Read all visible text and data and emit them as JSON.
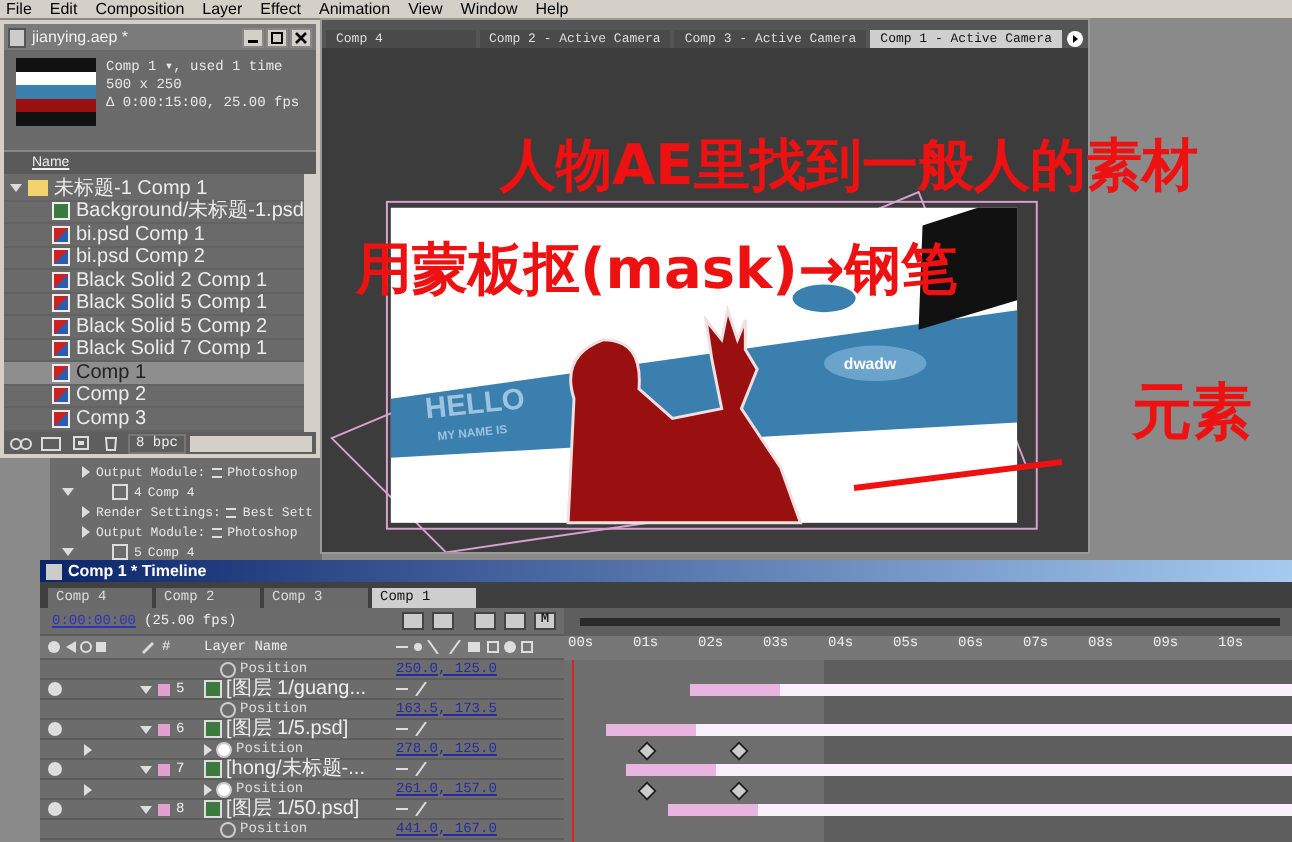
{
  "menu": [
    "File",
    "Edit",
    "Composition",
    "Layer",
    "Effect",
    "Animation",
    "View",
    "Window",
    "Help"
  ],
  "project": {
    "title": "jianying.aep *",
    "info": [
      "Comp 1 ▾, used 1 time",
      "500 x 250",
      "Δ 0:00:15:00, 25.00 fps"
    ],
    "column": "Name",
    "bpc": "8 bpc",
    "items": [
      {
        "name": "未标题-1 Comp 1",
        "kind": "folder",
        "expanded": true,
        "selected": false,
        "children": [
          {
            "name": "Background/未标题-1.psd",
            "kind": "footage",
            "selected": false
          },
          {
            "name": "bi.psd Comp 1",
            "kind": "comp",
            "selected": false
          },
          {
            "name": "bi.psd Comp 2",
            "kind": "comp",
            "selected": false
          },
          {
            "name": "Black Solid 2 Comp 1",
            "kind": "comp",
            "selected": false
          },
          {
            "name": "Black Solid 5 Comp 1",
            "kind": "comp",
            "selected": false
          },
          {
            "name": "Black Solid 5 Comp 2",
            "kind": "comp",
            "selected": false
          },
          {
            "name": "Black Solid 7 Comp 1",
            "kind": "comp",
            "selected": false
          },
          {
            "name": "Comp 1",
            "kind": "comp",
            "selected": true
          },
          {
            "name": "Comp 2",
            "kind": "comp",
            "selected": false
          },
          {
            "name": "Comp 3",
            "kind": "comp",
            "selected": false
          }
        ]
      }
    ]
  },
  "render_queue": [
    {
      "kind": "setting",
      "label": "Output Module:",
      "value": "Photoshop"
    },
    {
      "kind": "item",
      "number": "4",
      "name": "Comp 4",
      "checked": false
    },
    {
      "kind": "setting",
      "label": "Render Settings:",
      "value": "Best Sett"
    },
    {
      "kind": "setting",
      "label": "Output Module:",
      "value": "Photoshop"
    },
    {
      "kind": "item",
      "number": "5",
      "name": "Comp 4",
      "checked": false
    }
  ],
  "viewer": {
    "tabs": [
      {
        "label": "Comp 4",
        "selected": false
      },
      {
        "label": "Comp 2 - Active Camera",
        "selected": false
      },
      {
        "label": "Comp 3 - Active Camera",
        "selected": false
      },
      {
        "label": "Comp 1 - Active Camera",
        "selected": true
      }
    ],
    "artwork_texts": [
      "HELLO",
      "MY NAME IS",
      "dwadw"
    ]
  },
  "annotations": [
    "人物AE里找到一般人的素材",
    "用蒙板抠(mask)→钢笔",
    "元素"
  ],
  "timeline": {
    "title": "Comp 1 * Timeline",
    "tabs": [
      {
        "label": "Comp 4",
        "selected": false
      },
      {
        "label": "Comp 2",
        "selected": false
      },
      {
        "label": "Comp 3",
        "selected": false
      },
      {
        "label": "Comp 1",
        "selected": true
      }
    ],
    "time": "0:00:00:00",
    "fps": "(25.00 fps)",
    "toolbar_label": "M",
    "number_column": "#",
    "column": "Layer Name",
    "ruler": [
      "00s",
      "01s",
      "02s",
      "03s",
      "04s",
      "05s",
      "06s",
      "07s",
      "08s",
      "09s",
      "10s"
    ],
    "rows": [
      {
        "kind": "property",
        "name": "Position",
        "value": "250.0, 125.0",
        "animated": false
      },
      {
        "kind": "layer",
        "number": "5",
        "name": "[图层 1/guang..."
      },
      {
        "kind": "property",
        "name": "Position",
        "value": "163.5, 173.5",
        "animated": false
      },
      {
        "kind": "layer",
        "number": "6",
        "name": "[图层 1/5.psd]"
      },
      {
        "kind": "property",
        "name": "Position",
        "value": "278.0, 125.0",
        "animated": true
      },
      {
        "kind": "layer",
        "number": "7",
        "name": "[hong/未标题-..."
      },
      {
        "kind": "property",
        "name": "Position",
        "value": "261.0, 157.0",
        "animated": true
      },
      {
        "kind": "layer",
        "number": "8",
        "name": "[图层 1/50.psd]"
      },
      {
        "kind": "property",
        "name": "Position",
        "value": "441.0, 167.0",
        "animated": false
      }
    ]
  }
}
